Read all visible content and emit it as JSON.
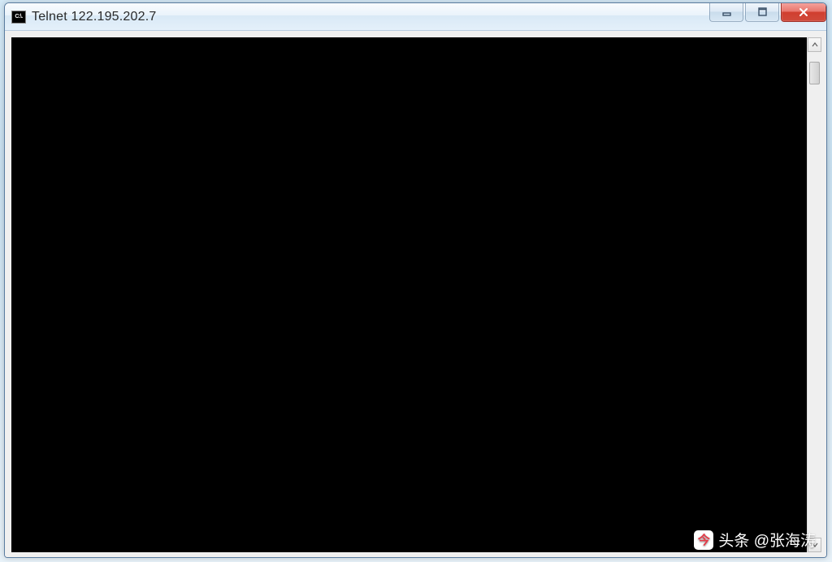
{
  "window": {
    "title": "Telnet 122.195.202.7",
    "app_icon_text": "C:\\."
  },
  "controls": {
    "minimize": "minimize",
    "maximize": "maximize",
    "close": "close"
  },
  "terminal": {
    "content": ""
  },
  "watermark": {
    "logo_text": "今",
    "text": "头条 @张海涛"
  }
}
